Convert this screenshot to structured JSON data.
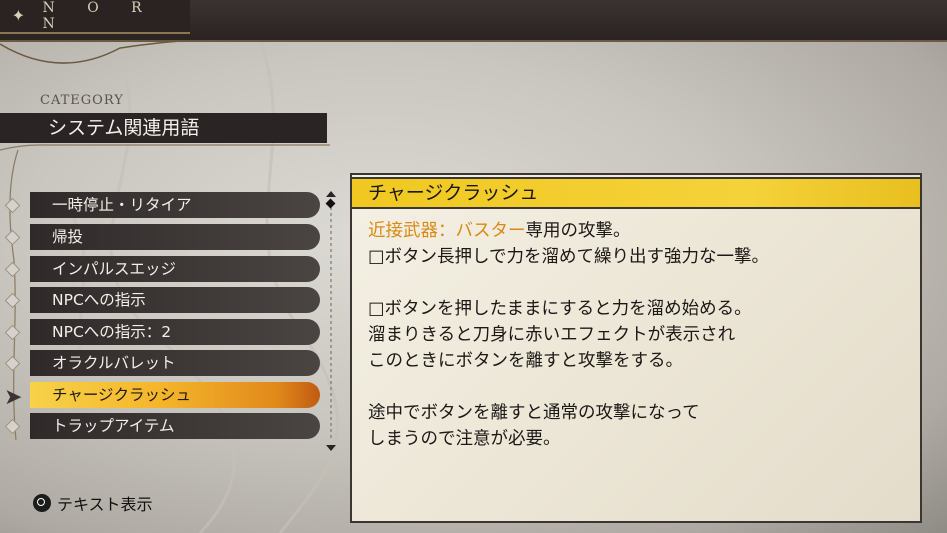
{
  "header": {
    "logo_text": "N O R N"
  },
  "category": {
    "label": "CATEGORY",
    "title": "システム関連用語"
  },
  "menu": {
    "items": [
      {
        "label": "一時停止・リタイア",
        "selected": false
      },
      {
        "label": "帰投",
        "selected": false
      },
      {
        "label": "インパルスエッジ",
        "selected": false
      },
      {
        "label": "NPCへの指示",
        "selected": false
      },
      {
        "label": "NPCへの指示：2",
        "selected": false
      },
      {
        "label": "オラクルバレット",
        "selected": false
      },
      {
        "label": "チャージクラッシュ",
        "selected": true
      },
      {
        "label": "トラップアイテム",
        "selected": false
      }
    ]
  },
  "content": {
    "title": "チャージクラッシュ",
    "highlight": "近接武器：バスター",
    "line1_rest": "専用の攻撃。",
    "line2": "□ボタン長押しで力を溜めて繰り出す強力な一撃。",
    "line3": "□ボタンを押したままにすると力を溜め始める。",
    "line4": "溜まりきると刀身に赤いエフェクトが表示され",
    "line5": "このときにボタンを離すと攻撃をする。",
    "line6": "途中でボタンを離すと通常の攻撃になって",
    "line7": "しまうので注意が必要。"
  },
  "footer": {
    "hint_label": "テキスト表示"
  },
  "colors": {
    "accent": "#f5c21f",
    "panel_dark": "#2a2524"
  }
}
